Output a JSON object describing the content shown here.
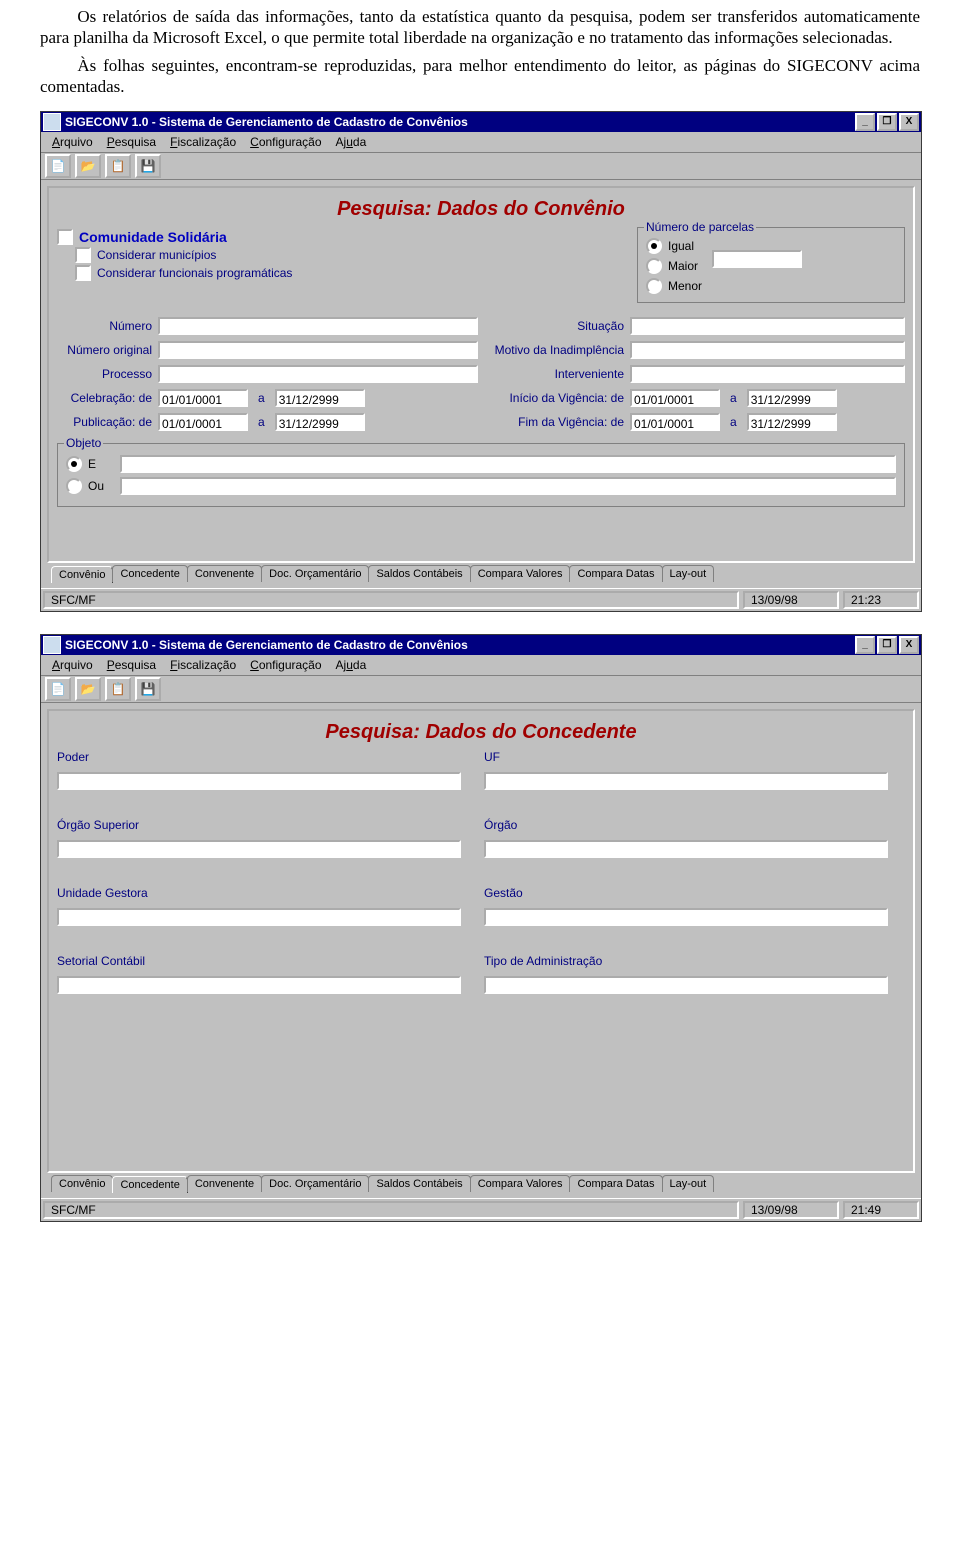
{
  "doc": {
    "p1": "Os relatórios de saída das informações, tanto da estatística quanto da pesquisa, podem ser transferidos automaticamente para planilha da Microsoft Excel, o que permite total liberdade na organização e no tratamento das informações selecionadas.",
    "p2": "Às folhas seguintes, encontram-se reproduzidas, para melhor entendimento do leitor, as páginas do SIGECONV acima comentadas."
  },
  "common": {
    "titlebar": "SIGECONV 1.0 - Sistema de Gerenciamento de Cadastro de Convênios",
    "menus": {
      "arquivo": "Arquivo",
      "pesquisa": "Pesquisa",
      "fiscalizacao": "Fiscalização",
      "configuracao": "Configuração",
      "ajuda": "Ajuda"
    },
    "winbtns": {
      "min": "_",
      "max": "❐",
      "close": "X"
    },
    "tabs": [
      "Convênio",
      "Concedente",
      "Convenente",
      "Doc. Orçamentário",
      "Saldos Contábeis",
      "Compara Valores",
      "Compara Datas",
      "Lay-out"
    ],
    "status_org": "SFC/MF"
  },
  "screen1": {
    "pagetitle": "Pesquisa: Dados do Convênio",
    "cs": "Comunidade Solidária",
    "cs_mun": "Considerar municípios",
    "cs_fun": "Considerar funcionais programáticas",
    "parcelas": {
      "legend": "Número de parcelas",
      "igual": "Igual",
      "maior": "Maior",
      "menor": "Menor",
      "valor": ""
    },
    "fields": {
      "numero": "Número",
      "num_original": "Número original",
      "processo": "Processo",
      "situacao": "Situação",
      "motivo": "Motivo da Inadimplência",
      "interveniente": "Interveniente",
      "celebracao": "Celebração: de",
      "publicacao": "Publicação: de",
      "inicio_vig": "Início da Vigência: de",
      "fim_vig": "Fim da Vigência: de",
      "a": "a"
    },
    "values": {
      "numero": "",
      "num_original": "",
      "processo": "",
      "situacao": "",
      "motivo": "",
      "interveniente": "",
      "celebracao_de": "01/01/0001",
      "celebracao_a": "31/12/2999",
      "publicacao_de": "01/01/0001",
      "publicacao_a": "31/12/2999",
      "iniciovig_de": "01/01/0001",
      "iniciovig_a": "31/12/2999",
      "fimvig_de": "01/01/0001",
      "fimvig_a": "31/12/2999"
    },
    "objeto": {
      "legend": "Objeto",
      "e": "E",
      "ou": "Ou",
      "linha1": "",
      "linha2": ""
    },
    "status_date": "13/09/98",
    "status_time": "21:23"
  },
  "screen2": {
    "pagetitle": "Pesquisa: Dados do Concedente",
    "labels": {
      "poder": "Poder",
      "uf": "UF",
      "orgao_sup": "Órgão Superior",
      "orgao": "Órgão",
      "ug": "Unidade Gestora",
      "gestao": "Gestão",
      "setorial": "Setorial Contábil",
      "tipoadm": "Tipo de Administração"
    },
    "values": {
      "poder": "",
      "uf": "",
      "orgao_sup": "",
      "orgao": "",
      "ug": "",
      "gestao": "",
      "setorial": "",
      "tipoadm": ""
    },
    "status_date": "13/09/98",
    "status_time": "21:49"
  }
}
